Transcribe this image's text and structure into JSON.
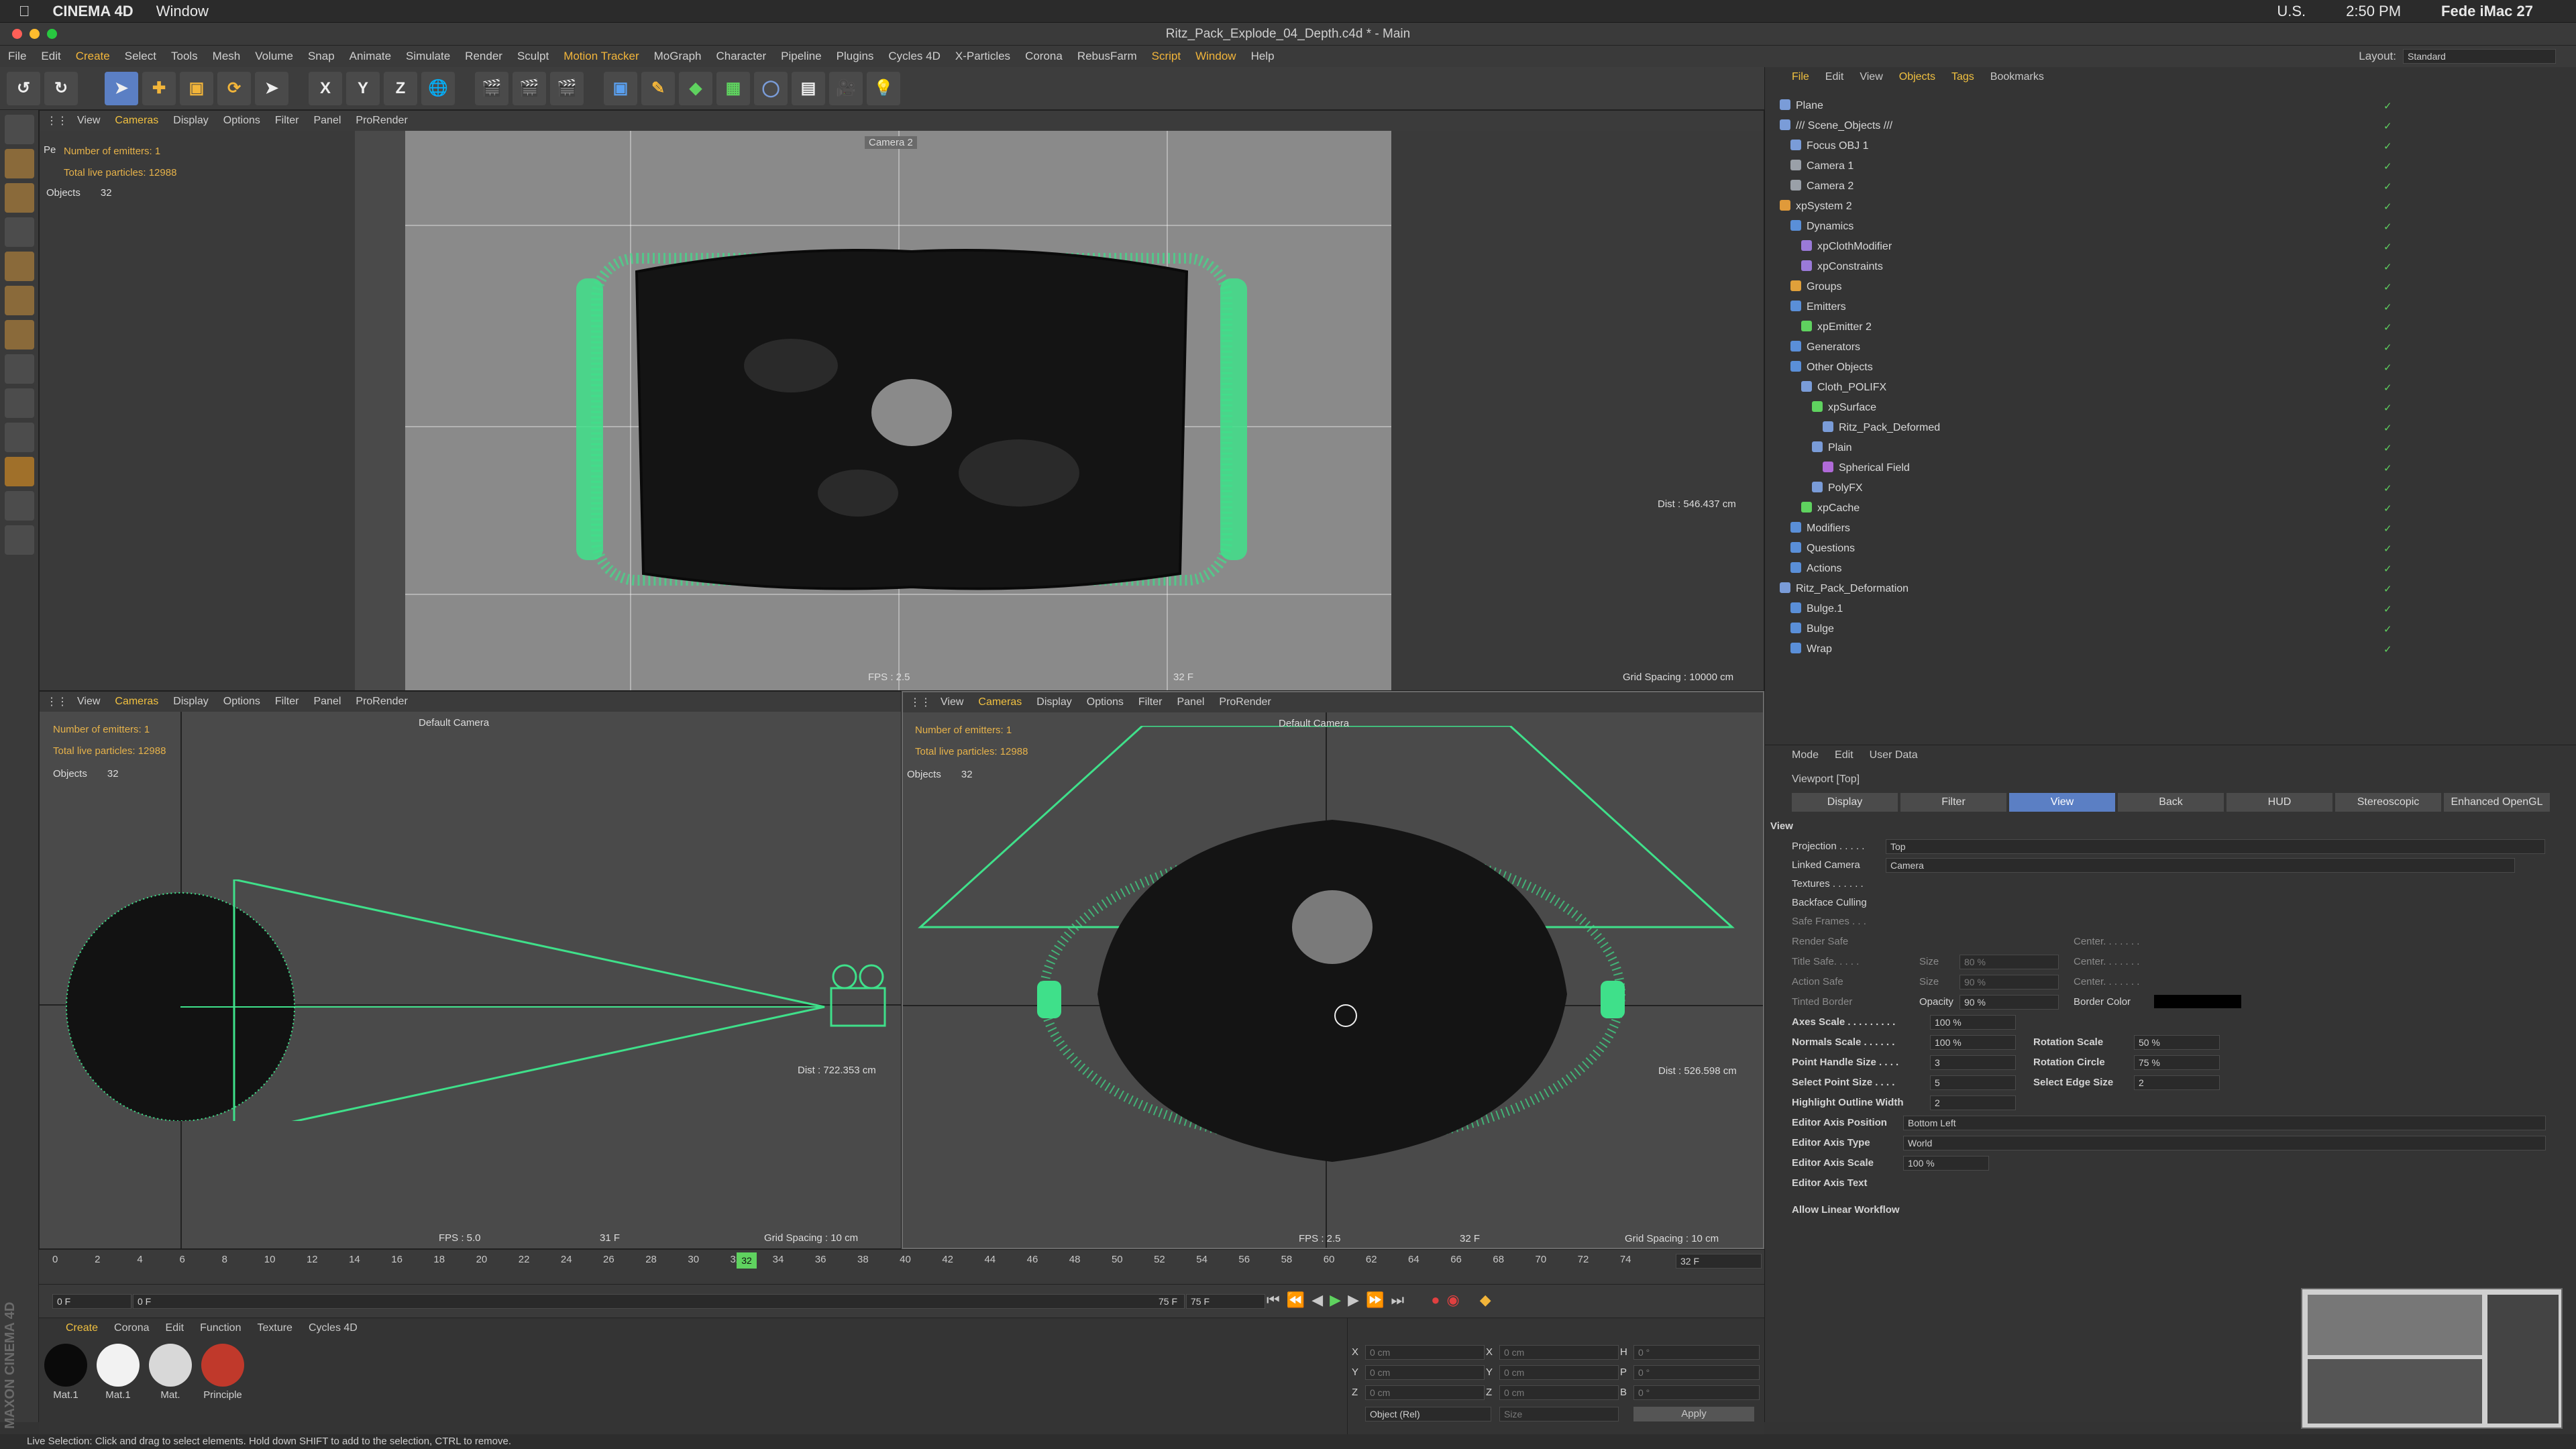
{
  "mac_menu": {
    "app": "CINEMA 4D",
    "window": "Window",
    "clock": "2:50 PM",
    "user": "Fede iMac 27",
    "locale": "U.S."
  },
  "window_title": "Ritz_Pack_Explode_04_Depth.c4d * - Main",
  "main_menu": [
    "File",
    "Edit",
    "Create",
    "Select",
    "Tools",
    "Mesh",
    "Volume",
    "Snap",
    "Animate",
    "Simulate",
    "Render",
    "Sculpt",
    "Motion Tracker",
    "MoGraph",
    "Character",
    "Pipeline",
    "Plugins",
    "Cycles 4D",
    "X-Particles",
    "Corona",
    "RebusFarm",
    "Script",
    "Window",
    "Help"
  ],
  "layout": {
    "label": "Layout:",
    "value": "Standard"
  },
  "toolbar": {
    "axis_x": "X",
    "axis_y": "Y",
    "axis_z": "Z"
  },
  "viewport_menu": [
    "View",
    "Cameras",
    "Display",
    "Options",
    "Filter",
    "Panel",
    "ProRender"
  ],
  "viewports": {
    "top": {
      "emitters": "Number of emitters: 1",
      "particles": "Total live particles: 12988",
      "objects_label": "Objects",
      "objects_count": "32",
      "camera": "Camera 2",
      "fps": "FPS : 2.5",
      "frame": "32 F",
      "dist": "Dist : 546.437 cm",
      "grid": "Grid Spacing : 10000 cm",
      "pe": "Pe"
    },
    "bottom_left": {
      "emitters": "Number of emitters: 1",
      "particles": "Total live particles: 12988",
      "objects_label": "Objects",
      "objects_count": "32",
      "camera": "Default Camera",
      "fps": "FPS : 5.0",
      "frame": "31 F",
      "dist": "Dist : 722.353 cm",
      "grid": "Grid Spacing : 10 cm"
    },
    "bottom_right": {
      "emitters": "Number of emitters: 1",
      "particles": "Total live particles: 12988",
      "objects_label": "Objects",
      "objects_count": "32",
      "camera": "Default Camera",
      "fps": "FPS : 2.5",
      "frame": "32 F",
      "dist": "Dist : 526.598 cm",
      "grid": "Grid Spacing : 10 cm"
    }
  },
  "object_manager": {
    "menu": [
      "File",
      "Edit",
      "View",
      "Objects",
      "Tags",
      "Bookmarks"
    ],
    "objects": [
      {
        "name": "Plane",
        "depth": 0,
        "color": "#7a9cd8"
      },
      {
        "name": "/// Scene_Objects ///",
        "depth": 0,
        "color": "#7a9cd8"
      },
      {
        "name": "Focus OBJ 1",
        "depth": 1,
        "color": "#7a9cd8"
      },
      {
        "name": "Camera 1",
        "depth": 1,
        "color": "#9aa0a8"
      },
      {
        "name": "Camera 2",
        "depth": 1,
        "color": "#9aa0a8"
      },
      {
        "name": "xpSystem 2",
        "depth": 0,
        "color": "#e09a3a"
      },
      {
        "name": "Dynamics",
        "depth": 1,
        "color": "#5a8fd8"
      },
      {
        "name": "xpClothModifier",
        "depth": 2,
        "color": "#9a7ad8"
      },
      {
        "name": "xpConstraints",
        "depth": 2,
        "color": "#9a7ad8"
      },
      {
        "name": "Groups",
        "depth": 1,
        "color": "#e0a03a"
      },
      {
        "name": "Emitters",
        "depth": 1,
        "color": "#5a8fd8"
      },
      {
        "name": "xpEmitter 2",
        "depth": 2,
        "color": "#5fd25f"
      },
      {
        "name": "Generators",
        "depth": 1,
        "color": "#5a8fd8"
      },
      {
        "name": "Other Objects",
        "depth": 1,
        "color": "#5a8fd8"
      },
      {
        "name": "Cloth_POLIFX",
        "depth": 2,
        "color": "#7a9cd8"
      },
      {
        "name": "xpSurface",
        "depth": 3,
        "color": "#5fd25f"
      },
      {
        "name": "Ritz_Pack_Deformed",
        "depth": 4,
        "color": "#7a9cd8"
      },
      {
        "name": "Plain",
        "depth": 3,
        "color": "#7a9cd8"
      },
      {
        "name": "Spherical Field",
        "depth": 4,
        "color": "#b06ad8"
      },
      {
        "name": "PolyFX",
        "depth": 3,
        "color": "#7a9cd8"
      },
      {
        "name": "xpCache",
        "depth": 2,
        "color": "#5fd25f"
      },
      {
        "name": "Modifiers",
        "depth": 1,
        "color": "#5a8fd8"
      },
      {
        "name": "Questions",
        "depth": 1,
        "color": "#5a8fd8"
      },
      {
        "name": "Actions",
        "depth": 1,
        "color": "#5a8fd8"
      },
      {
        "name": "Ritz_Pack_Deformation",
        "depth": 0,
        "color": "#7a9cd8"
      },
      {
        "name": "Bulge.1",
        "depth": 1,
        "color": "#5a8fd8"
      },
      {
        "name": "Bulge",
        "depth": 1,
        "color": "#5a8fd8"
      },
      {
        "name": "Wrap",
        "depth": 1,
        "color": "#5a8fd8"
      }
    ]
  },
  "attributes": {
    "menu": [
      "Mode",
      "Edit",
      "User Data"
    ],
    "title": "Viewport [Top]",
    "tabs": [
      "Display",
      "Filter",
      "View",
      "Back",
      "HUD",
      "Stereoscopic",
      "Enhanced OpenGL"
    ],
    "active_tab": "View",
    "section": "View",
    "projection_label": "Projection . . . . .",
    "projection_value": "Top",
    "linked_camera_label": "Linked Camera",
    "linked_camera_value": "Camera",
    "textures": "Textures . . . . . .",
    "backface": "Backface Culling",
    "safe_frames": "Safe Frames . . .",
    "render_safe": "Render Safe",
    "title_safe": "Title Safe. . . . .",
    "action_safe": "Action Safe",
    "tinted_border": "Tinted Border",
    "size_label": "Size",
    "size_80": "80 %",
    "size_90": "90 %",
    "center_label": "Center. . . . . . .",
    "opacity_label": "Opacity",
    "opacity_value": "90 %",
    "border_color_label": "Border Color",
    "axes_scale": "Axes Scale . . . . . . . . .",
    "axes_scale_value": "100 %",
    "normals_scale": "Normals Scale . . . . . .",
    "normals_scale_value": "100 %",
    "rotation_scale": "Rotation Scale",
    "rotation_scale_value": "50 %",
    "point_handle": "Point Handle Size . . . .",
    "point_handle_value": "3",
    "rotation_circle": "Rotation Circle",
    "rotation_circle_value": "75 %",
    "select_point": "Select Point Size . . . .",
    "select_point_value": "5",
    "select_edge": "Select Edge Size",
    "select_edge_value": "2",
    "highlight": "Highlight Outline Width",
    "highlight_value": "2",
    "editor_axis_pos": "Editor Axis Position",
    "editor_axis_pos_value": "Bottom Left",
    "editor_axis_type": "Editor Axis Type",
    "editor_axis_type_value": "World",
    "editor_axis_scale": "Editor Axis Scale",
    "editor_axis_scale_value": "100 %",
    "editor_axis_text": "Editor Axis Text",
    "linear_workflow": "Allow Linear Workflow"
  },
  "timeline": {
    "ticks": [
      "0",
      "2",
      "4",
      "6",
      "8",
      "10",
      "12",
      "14",
      "16",
      "18",
      "20",
      "22",
      "24",
      "26",
      "28",
      "30",
      "32",
      "34",
      "36",
      "38",
      "40",
      "42",
      "44",
      "46",
      "48",
      "50",
      "52",
      "54",
      "56",
      "58",
      "60",
      "62",
      "64",
      "66",
      "68",
      "70",
      "72",
      "74"
    ],
    "current": "32",
    "current_frame_box": "32 F",
    "start": "0 F",
    "start2": "0 F",
    "end": "75 F",
    "end2": "75 F"
  },
  "materials": {
    "menu": [
      "Create",
      "Corona",
      "Edit",
      "Function",
      "Texture",
      "Cycles 4D"
    ],
    "items": [
      {
        "label": "Mat.1",
        "color": "#0a0a0a"
      },
      {
        "label": "Mat.1",
        "color": "#f2f2f2"
      },
      {
        "label": "Mat.",
        "color": "#d8d8d8"
      },
      {
        "label": "Principle",
        "color": "#c0392b"
      }
    ]
  },
  "coordinates": {
    "x": "X",
    "y": "Y",
    "z": "Z",
    "h": "H",
    "p": "P",
    "b": "B",
    "val_cm": "0 cm",
    "val_deg": "0 °",
    "mode": "Object (Rel)",
    "size": "Size",
    "apply": "Apply"
  },
  "status": "Live Selection: Click and drag to select elements. Hold down SHIFT to add to the selection, CTRL to remove.",
  "maxon": "MAXON CINEMA 4D"
}
